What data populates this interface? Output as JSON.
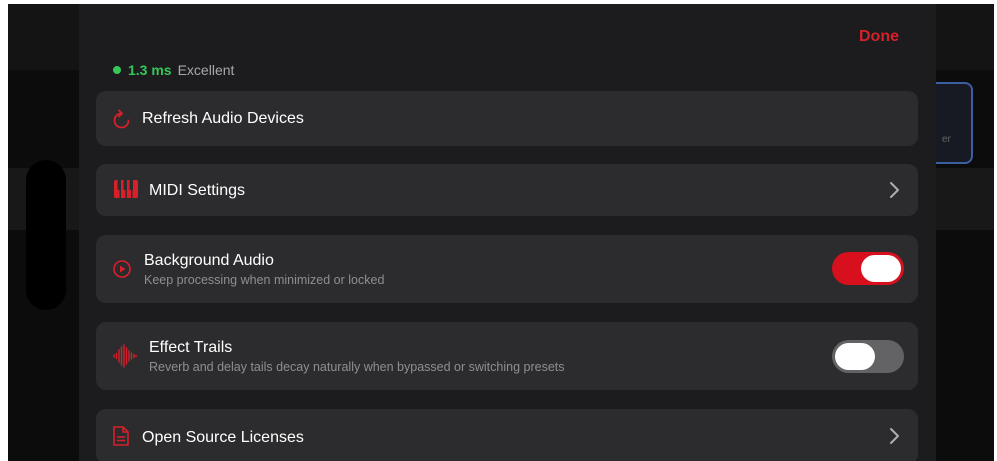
{
  "header": {
    "done_label": "Done"
  },
  "status": {
    "latency_value": "1.3 ms",
    "latency_quality": "Excellent",
    "color": "#34c759"
  },
  "background": {
    "partial_text": "er"
  },
  "rows": {
    "refresh": {
      "label": "Refresh Audio Devices",
      "icon": "refresh-icon"
    },
    "midi": {
      "label": "MIDI Settings",
      "icon": "piano-keys-icon"
    },
    "background_audio": {
      "label": "Background Audio",
      "subtitle": "Keep processing when minimized or locked",
      "icon": "play-circle-icon",
      "enabled": true
    },
    "effect_trails": {
      "label": "Effect Trails",
      "subtitle": "Reverb and delay tails decay naturally when bypassed or switching presets",
      "icon": "waveform-icon",
      "enabled": false
    },
    "licenses": {
      "label": "Open Source Licenses",
      "icon": "document-icon"
    }
  },
  "colors": {
    "accent": "#d8202a",
    "toggle_on": "#d8101e",
    "toggle_off": "#636366",
    "row_background": "#2c2c2e",
    "sheet_background": "#1c1c1e"
  }
}
